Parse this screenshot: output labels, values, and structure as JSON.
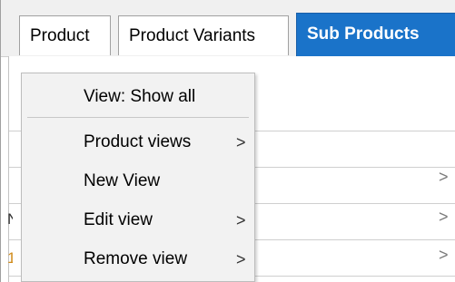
{
  "tabs": [
    {
      "label": "Product",
      "active": false
    },
    {
      "label": "Product Variants",
      "active": false
    },
    {
      "label": "Sub Products",
      "active": true
    }
  ],
  "context_menu": {
    "items": [
      {
        "label": "View: Show all",
        "has_submenu": false
      },
      {
        "label": "Product views",
        "has_submenu": true
      },
      {
        "label": "New View",
        "has_submenu": false
      },
      {
        "label": "Edit view",
        "has_submenu": true
      },
      {
        "label": "Remove view",
        "has_submenu": true
      }
    ],
    "submenu_glyph": ">"
  },
  "rows": {
    "arrow_glyph": ">",
    "edge_fragments": [
      "N",
      "1"
    ]
  },
  "colors": {
    "active_tab_bg": "#1a73c9",
    "menu_bg": "#f2f2f2",
    "tabstrip_bg": "#f0f0f0"
  }
}
